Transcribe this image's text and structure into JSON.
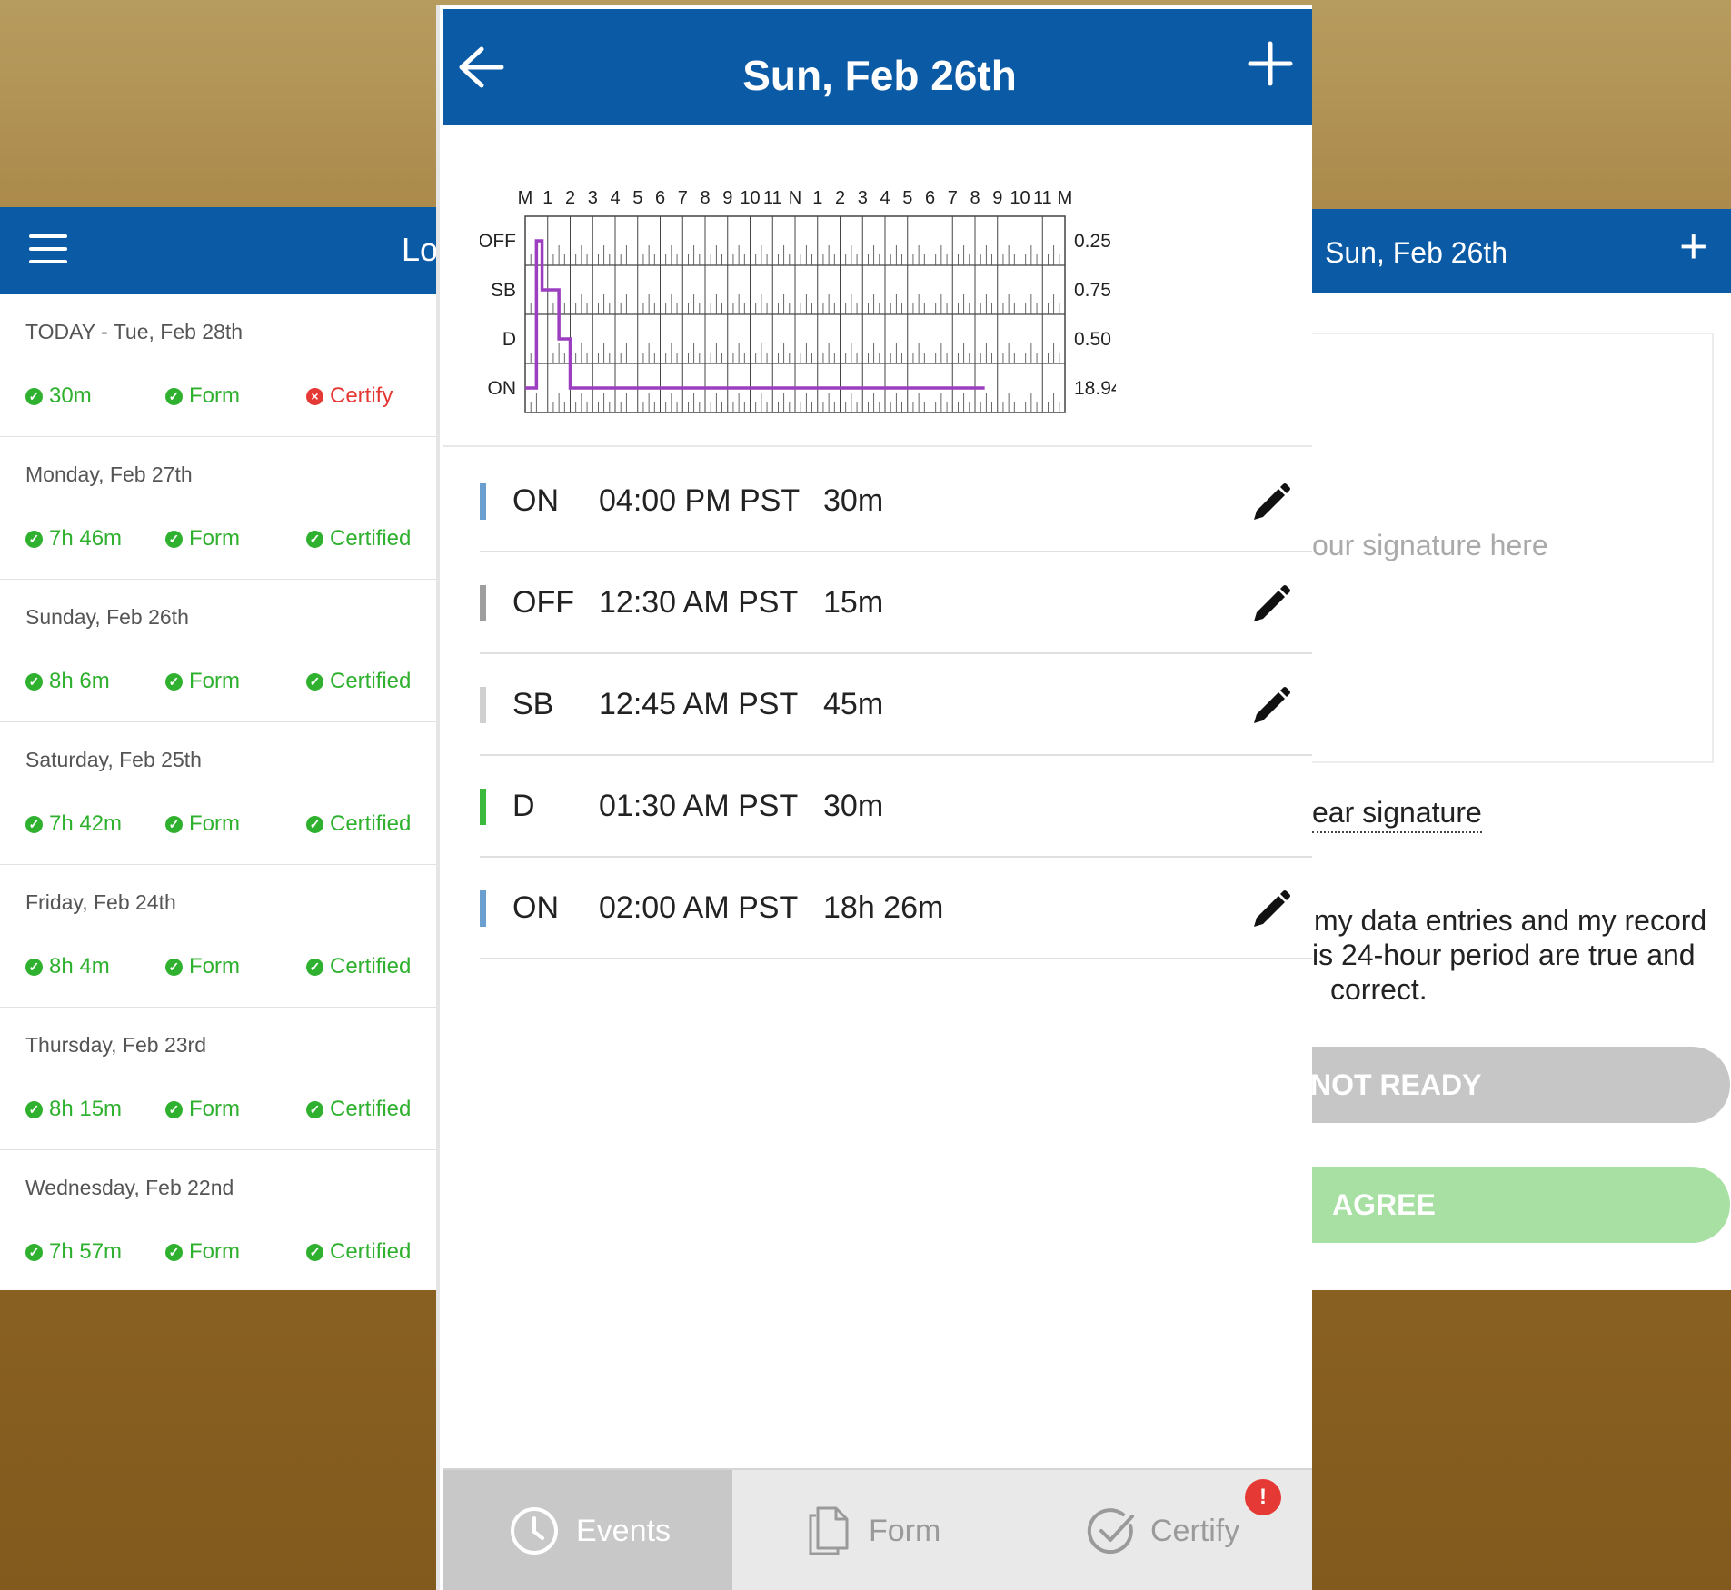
{
  "left": {
    "title": "Lo",
    "rows": [
      {
        "date": "TODAY - Tue, Feb 28th",
        "hours": "30m",
        "form": "Form",
        "certify": "Certify",
        "certified": false
      },
      {
        "date": "Monday, Feb 27th",
        "hours": "7h 46m",
        "form": "Form",
        "certify": "Certified",
        "certified": true
      },
      {
        "date": "Sunday, Feb 26th",
        "hours": "8h 6m",
        "form": "Form",
        "certify": "Certified",
        "certified": true
      },
      {
        "date": "Saturday, Feb 25th",
        "hours": "7h 42m",
        "form": "Form",
        "certify": "Certified",
        "certified": true
      },
      {
        "date": "Friday, Feb 24th",
        "hours": "8h 4m",
        "form": "Form",
        "certify": "Certified",
        "certified": true
      },
      {
        "date": "Thursday, Feb 23rd",
        "hours": "8h 15m",
        "form": "Form",
        "certify": "Certified",
        "certified": true
      },
      {
        "date": "Wednesday, Feb 22nd",
        "hours": "7h 57m",
        "form": "Form",
        "certify": "Certified",
        "certified": true
      }
    ]
  },
  "center": {
    "title": "Sun, Feb 26th",
    "graph": {
      "hour_labels": [
        "M",
        "1",
        "2",
        "3",
        "4",
        "5",
        "6",
        "7",
        "8",
        "9",
        "10",
        "11",
        "N",
        "1",
        "2",
        "3",
        "4",
        "5",
        "6",
        "7",
        "8",
        "9",
        "10",
        "11",
        "M"
      ],
      "status_labels": [
        "OFF",
        "SB",
        "D",
        "ON"
      ],
      "totals": [
        "0.25",
        "0.75",
        "0.50",
        "18.94"
      ],
      "segments": [
        {
          "status": "ON",
          "start": 0.0,
          "end": 0.5
        },
        {
          "status": "OFF",
          "start": 0.5,
          "end": 0.75
        },
        {
          "status": "SB",
          "start": 0.75,
          "end": 1.5
        },
        {
          "status": "D",
          "start": 1.5,
          "end": 2.0
        },
        {
          "status": "ON",
          "start": 2.0,
          "end": 20.43
        }
      ],
      "line_color": "#9b3fc0"
    },
    "events": [
      {
        "status": "ON",
        "time": "04:00 PM PST",
        "duration": "30m",
        "color": "#6a9fd0",
        "editable": true
      },
      {
        "status": "OFF",
        "time": "12:30 AM PST",
        "duration": "15m",
        "color": "#9e9e9e",
        "editable": true
      },
      {
        "status": "SB",
        "time": "12:45 AM PST",
        "duration": "45m",
        "color": "#d0d0d0",
        "editable": true
      },
      {
        "status": "D",
        "time": "01:30 AM PST",
        "duration": "30m",
        "color": "#3cb83c",
        "editable": false
      },
      {
        "status": "ON",
        "time": "02:00 AM PST",
        "duration": "18h 26m",
        "color": "#6a9fd0",
        "editable": true
      }
    ],
    "nav": {
      "events": "Events",
      "form": "Form",
      "certify": "Certify",
      "badge": "!"
    }
  },
  "right": {
    "title": "Sun, Feb 26th",
    "plus": "+",
    "signature_placeholder": "our signature here",
    "clear_signature": "ear signature",
    "certify_lines": [
      "my data entries and my record",
      "is 24-hour period are true and",
      "  correct."
    ],
    "not_ready": "NOT READY",
    "agree": "AGREE"
  },
  "colors": {
    "header_blue": "#0b5aa6",
    "green": "#2fb12f",
    "red": "#e53935"
  }
}
